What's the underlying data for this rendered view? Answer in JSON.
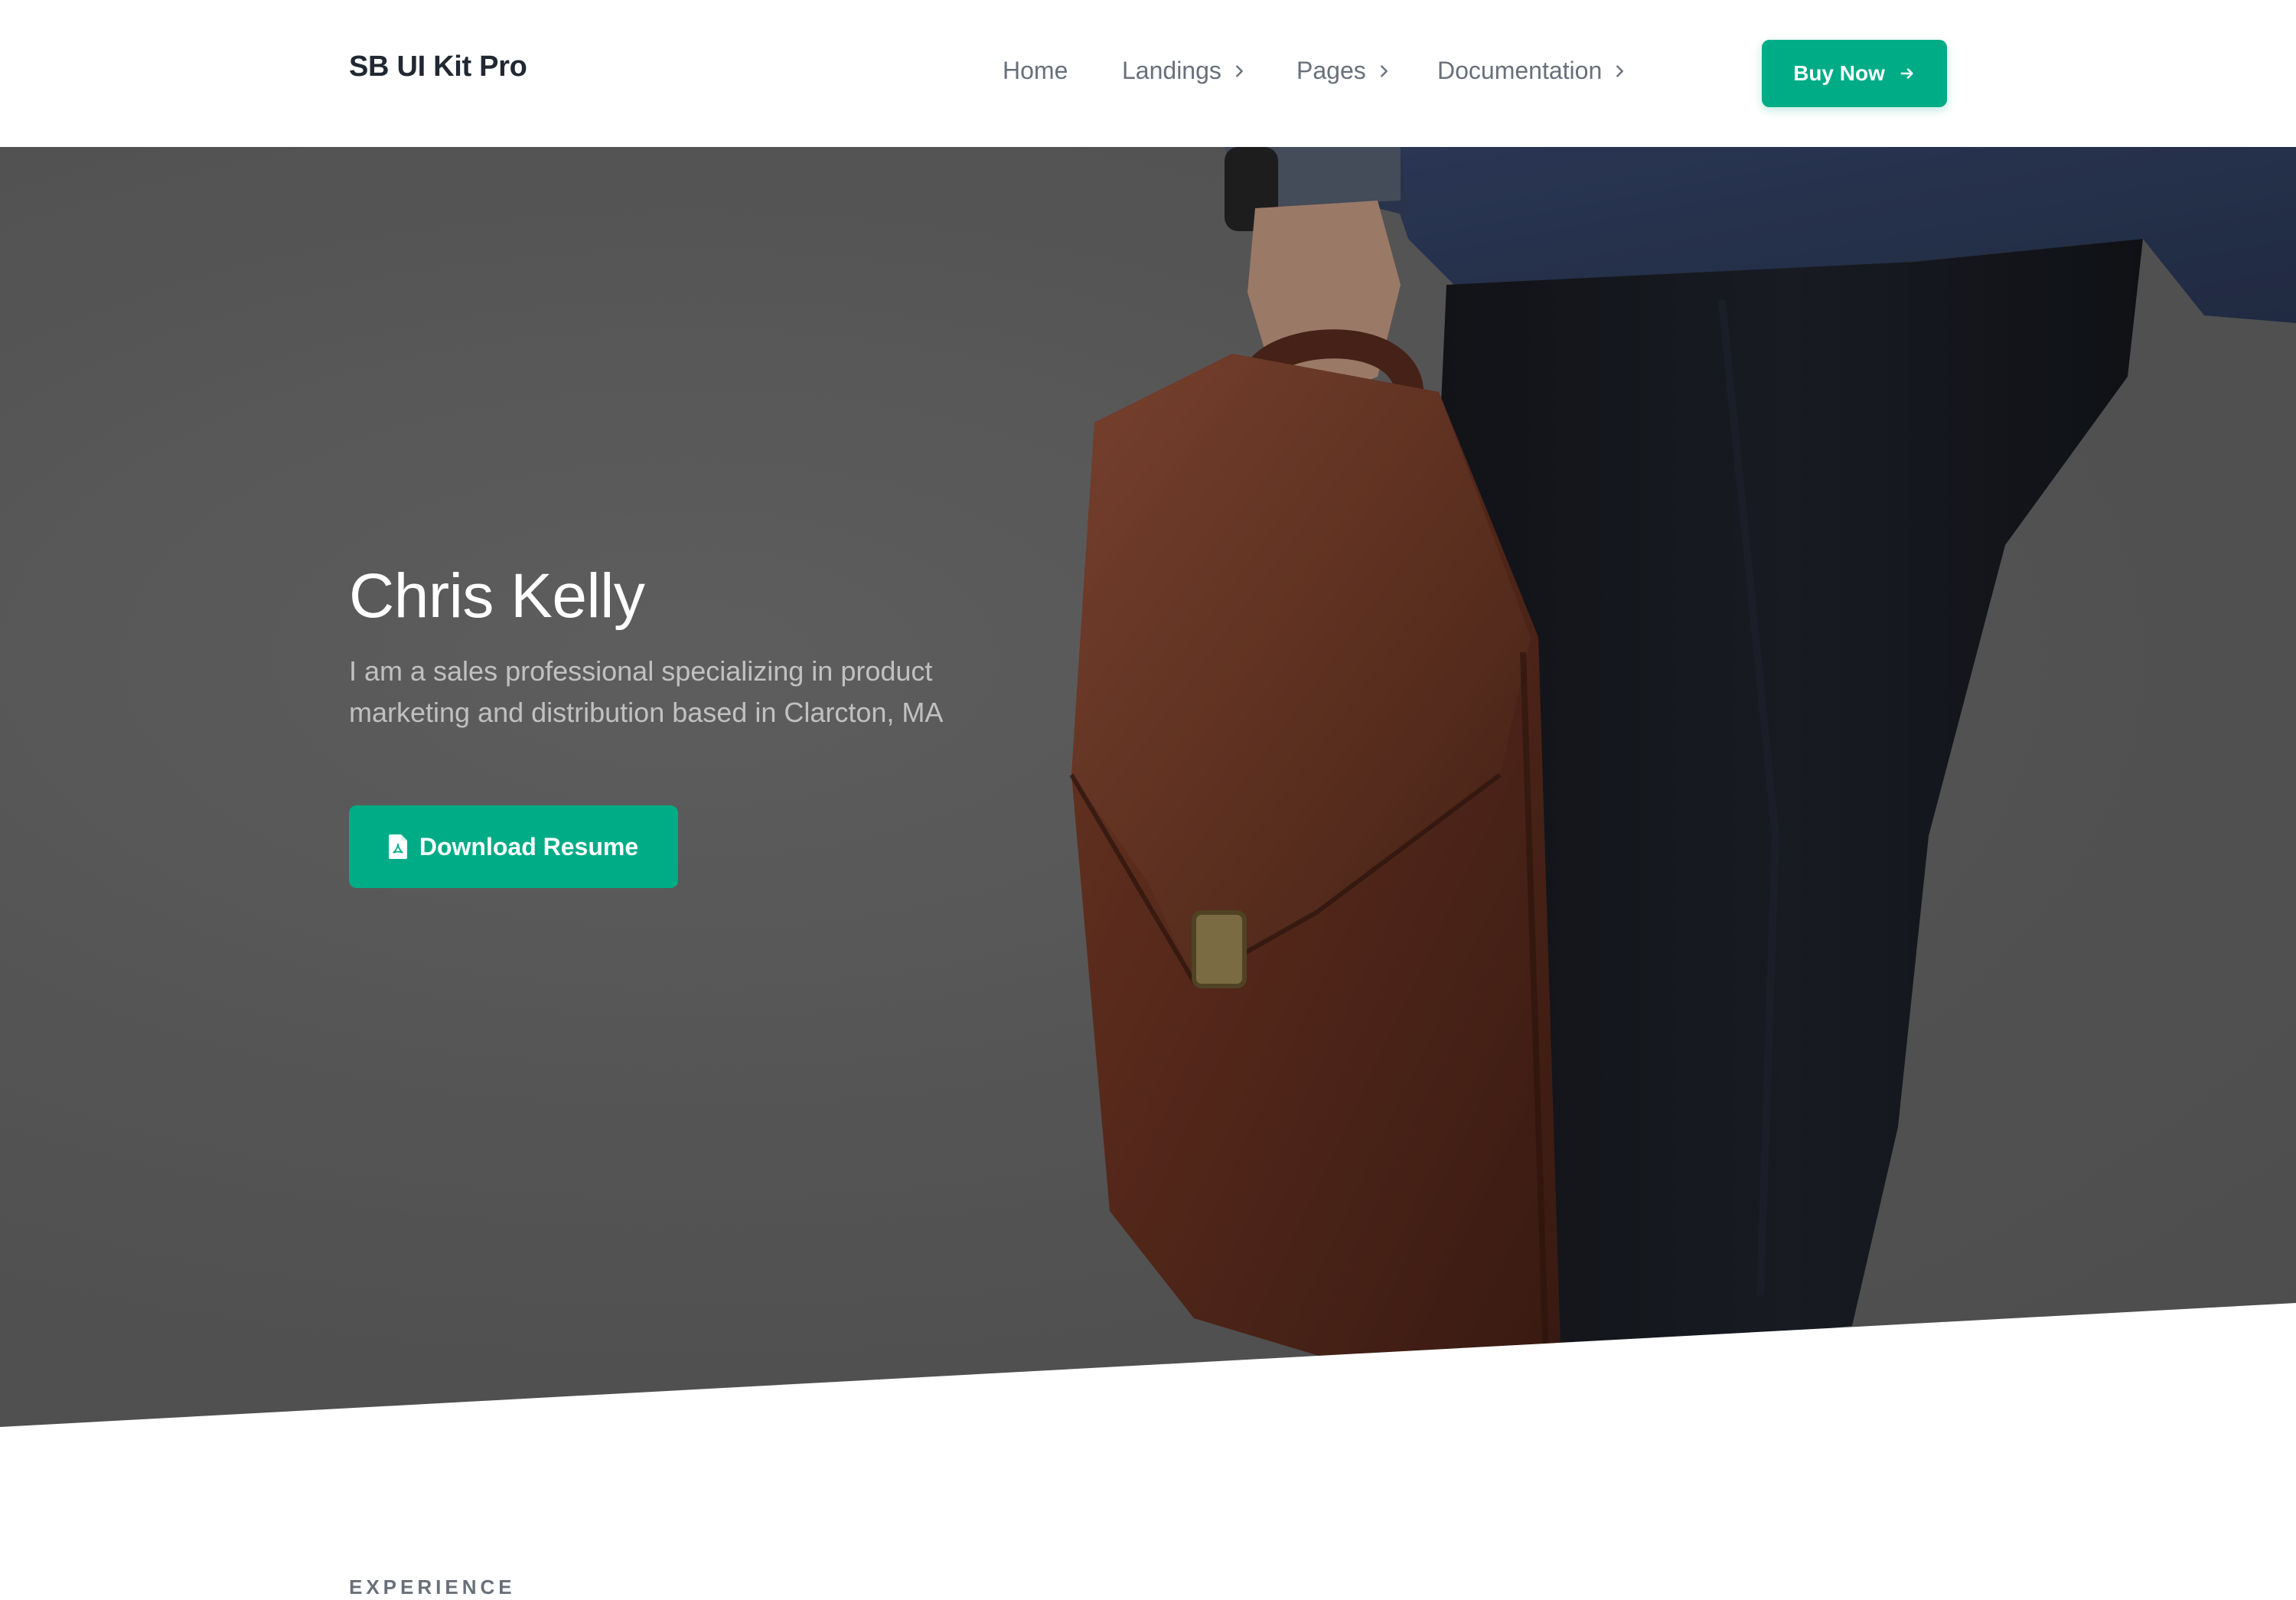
{
  "navbar": {
    "brand": "SB UI Kit Pro",
    "items": [
      {
        "label": "Home"
      },
      {
        "label": "Landings"
      },
      {
        "label": "Pages"
      },
      {
        "label": "Documentation"
      }
    ],
    "cta_label": "Buy Now",
    "cta_icon": "arrow-right-icon"
  },
  "hero": {
    "title": "Chris Kelly",
    "subtitle": "I am a sales professional specializing in product marketing and distribution based in Clarcton, MA",
    "button_label": "Download Resume",
    "button_icon": "file-pdf-icon"
  },
  "section": {
    "label": "EXPERIENCE"
  },
  "colors": {
    "accent": "#00ac86",
    "text_dark": "#212832",
    "text_muted": "#69707a",
    "hero_overlay": "#5c5c5c"
  }
}
